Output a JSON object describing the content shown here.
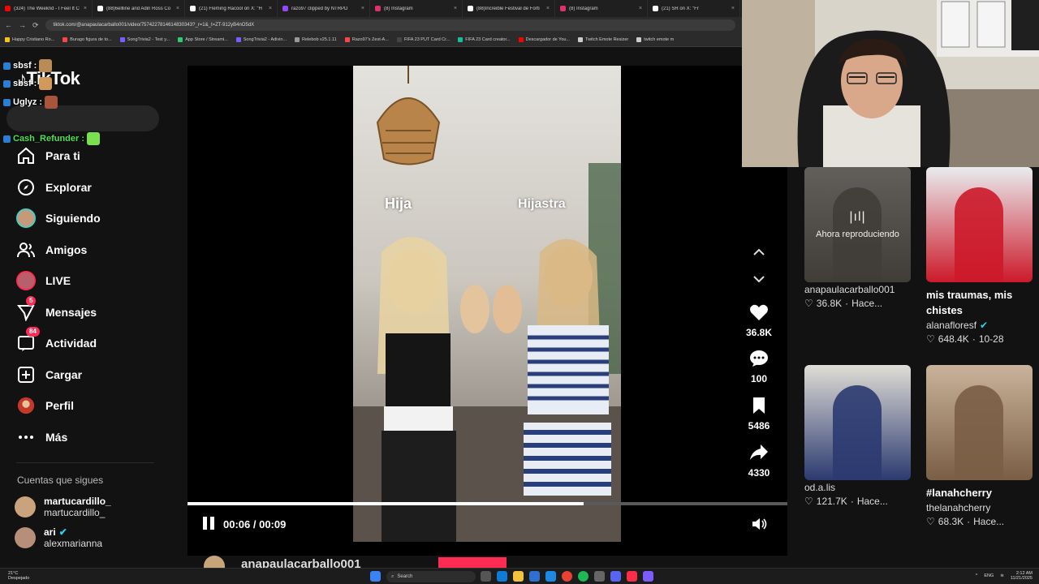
{
  "browser": {
    "tabs": [
      {
        "title": "(324) The Weeknd - I Feel It C",
        "color": "#ff0000"
      },
      {
        "title": "(88)6ellline and Adin Ross Co",
        "color": "#ffffff"
      },
      {
        "title": "(21) Fleming Racool on X: \"H",
        "color": "#ffffff"
      },
      {
        "title": "razo97 clipped by NTRPD",
        "color": "#9146ff"
      },
      {
        "title": "(8) Instagram",
        "color": "#e1306c"
      },
      {
        "title": "(88)Increible Festival de Forti",
        "color": "#ffffff"
      },
      {
        "title": "(8) Instagram",
        "color": "#e1306c"
      },
      {
        "title": "(21) SR on X: \"Fr",
        "color": "#ffffff"
      }
    ],
    "url": "tiktok.com/@anapaulacarballo001/video/7574227814614830343?_r=1&_t=ZT-912yB4nO5dX",
    "bookmarks": [
      {
        "label": "Happy Cristiano Ro...",
        "color": "#f5c518"
      },
      {
        "label": "Burago figura de to...",
        "color": "#ff4444"
      },
      {
        "label": "SongTrivia2 - Test y...",
        "color": "#7b5cff"
      },
      {
        "label": "App Store / Streami...",
        "color": "#2ecc71"
      },
      {
        "label": "SongTrivia2 - Adivin...",
        "color": "#7b5cff"
      },
      {
        "label": "Relebob v25.1.11",
        "color": "#999999"
      },
      {
        "label": "Razo97's Zest-A...",
        "color": "#ff4444"
      },
      {
        "label": "FIFA 23 PUT Card Cr...",
        "color": "#444444"
      },
      {
        "label": "FIFA 23 Card creator...",
        "color": "#1abc9c"
      },
      {
        "label": "Descargador de You...",
        "color": "#ff0000"
      },
      {
        "label": "Twitch Emote Resizer",
        "color": "#cccccc"
      },
      {
        "label": "twitch emote m",
        "color": "#cccccc"
      }
    ]
  },
  "sidebar": {
    "logo": "TikTok",
    "chat": [
      {
        "user": "sbsf :",
        "color": "#ffffff",
        "emote": "#b98c55"
      },
      {
        "user": "sbsf :",
        "color": "#ffffff",
        "emote": "#d19a5c"
      },
      {
        "user": "Uglyz :",
        "color": "#ffffff",
        "emote": "#a8553c"
      },
      {
        "user": "Cash_Refunder :",
        "color": "#4fe053",
        "emote": "#7be04f"
      }
    ],
    "nav": [
      {
        "label": "Para ti",
        "icon": "home-icon"
      },
      {
        "label": "Explorar",
        "icon": "compass-icon"
      },
      {
        "label": "Siguiendo",
        "icon": "avatar-icon"
      },
      {
        "label": "Amigos",
        "icon": "friends-icon"
      },
      {
        "label": "LIVE",
        "icon": "live-icon"
      },
      {
        "label": "Mensajes",
        "icon": "send-icon",
        "badge": "5"
      },
      {
        "label": "Actividad",
        "icon": "inbox-icon",
        "badge": "84"
      },
      {
        "label": "Cargar",
        "icon": "upload-icon"
      },
      {
        "label": "Perfil",
        "icon": "profile-icon"
      },
      {
        "label": "Más",
        "icon": "more-icon"
      }
    ],
    "following_header": "Cuentas que sigues",
    "following": [
      {
        "name": "martucardillo_",
        "handle": "martucardillo_",
        "avatar_color": "#c9a27e"
      },
      {
        "name": "ari",
        "handle": "alexmarianna",
        "avatar_color": "#b58f7a"
      }
    ]
  },
  "player": {
    "labels": {
      "left": "Hija",
      "right": "Hijastra"
    },
    "time_current": "00:06",
    "time_total": "00:09",
    "progress": 0.66,
    "author": "anapaulacarballo001",
    "actions": {
      "likes": "36.8K",
      "comments": "100",
      "saves": "5486",
      "shares": "4330"
    }
  },
  "recommendations": [
    {
      "title": "",
      "now_playing": "Ahora reproduciendo",
      "user": "anapaulacarballo001",
      "verified": false,
      "likes": "36.8K",
      "date": "Hace...",
      "thumb_a": "#d8d3cb",
      "thumb_b": "#8f877c"
    },
    {
      "title": "mis traumas, mis chistes",
      "user": "alanafloresf",
      "verified": true,
      "likes": "648.4K",
      "date": "10-28",
      "thumb_a": "#e9ecef",
      "thumb_b": "#cc1a2a"
    },
    {
      "title": "",
      "user": "od.a.lis",
      "verified": false,
      "likes": "121.7K",
      "date": "Hace...",
      "thumb_a": "#e0ddd6",
      "thumb_b": "#2b3a70"
    },
    {
      "title": "#lanahcherry",
      "user": "thelanahcherry",
      "verified": false,
      "likes": "68.3K",
      "date": "Hace...",
      "thumb_a": "#c9b39a",
      "thumb_b": "#7a5e45"
    }
  ],
  "taskbar": {
    "weather_temp": "21°C",
    "weather_desc": "Despejado",
    "search": "Search",
    "lang": "ENG",
    "time": "2:12 AM",
    "date": "11/21/2025"
  },
  "colors": {
    "accent": "#fe2c55",
    "verified": "#20d5ec"
  }
}
